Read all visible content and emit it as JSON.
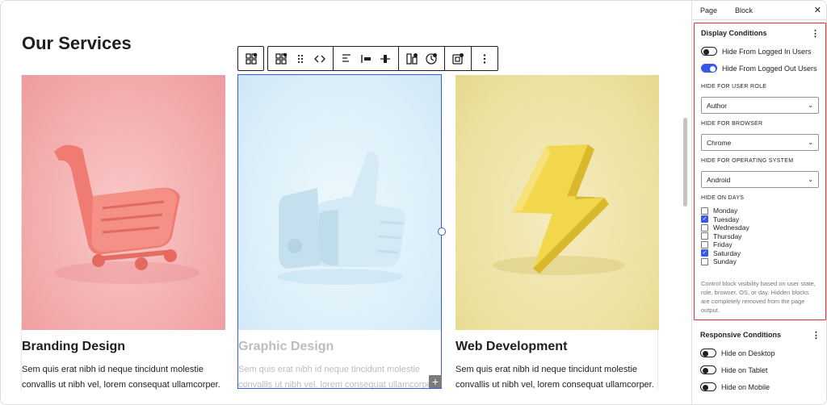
{
  "page": {
    "title": "Our Services"
  },
  "toolbar": {
    "parent_icon": "grid-parent-icon",
    "buttons": [
      "block-type-icon",
      "drag-handle-icon",
      "move-arrows-icon",
      "align-left-icon",
      "justify-icon",
      "vertical-align-icon",
      "visibility-icon",
      "animation-icon",
      "display-conditions-icon",
      "more-options-icon"
    ]
  },
  "cards": [
    {
      "title": "Branding Design",
      "text": "Sem quis erat nibh id neque tincidunt molestie convallis ut nibh vel, lorem consequat ullamcorper.",
      "image_icon": "shopping-cart-icon"
    },
    {
      "title": "Graphic Design",
      "text": "Sem quis erat nibh id neque tincidunt molestie convallis ut nibh vel, lorem consequat ullamcorper.",
      "image_icon": "thumbs-up-icon"
    },
    {
      "title": "Web Development",
      "text": "Sem quis erat nibh id neque tincidunt molestie convallis ut nibh vel, lorem consequat ullamcorper.",
      "image_icon": "lightning-bolt-icon"
    }
  ],
  "sidebar": {
    "tabs": [
      "Page",
      "Block"
    ],
    "close": "✕",
    "display_conditions": {
      "title": "Display Conditions",
      "toggles": [
        {
          "label": "Hide From Logged In Users",
          "on": false
        },
        {
          "label": "Hide From Logged Out Users",
          "on": true
        }
      ],
      "user_role": {
        "label": "HIDE FOR USER ROLE",
        "value": "Author"
      },
      "browser": {
        "label": "HIDE FOR BROWSER",
        "value": "Chrome"
      },
      "os": {
        "label": "HIDE FOR OPERATING SYSTEM",
        "value": "Android"
      },
      "days_label": "HIDE ON DAYS",
      "days": [
        {
          "label": "Monday",
          "checked": false
        },
        {
          "label": "Tuesday",
          "checked": true
        },
        {
          "label": "Wednesday",
          "checked": false
        },
        {
          "label": "Thursday",
          "checked": false
        },
        {
          "label": "Friday",
          "checked": false
        },
        {
          "label": "Saturday",
          "checked": true
        },
        {
          "label": "Sunday",
          "checked": false
        }
      ],
      "help": "Control block visibility based on user state, role, browser, OS, or day. Hidden blocks are completely removed from the page output."
    },
    "responsive_conditions": {
      "title": "Responsive Conditions",
      "toggles": [
        {
          "label": "Hide on Desktop",
          "on": false
        },
        {
          "label": "Hide on Tablet",
          "on": false
        },
        {
          "label": "Hide on Mobile",
          "on": false
        }
      ]
    }
  },
  "colors": {
    "accent": "#3858e9",
    "highlight": "#e03131"
  }
}
